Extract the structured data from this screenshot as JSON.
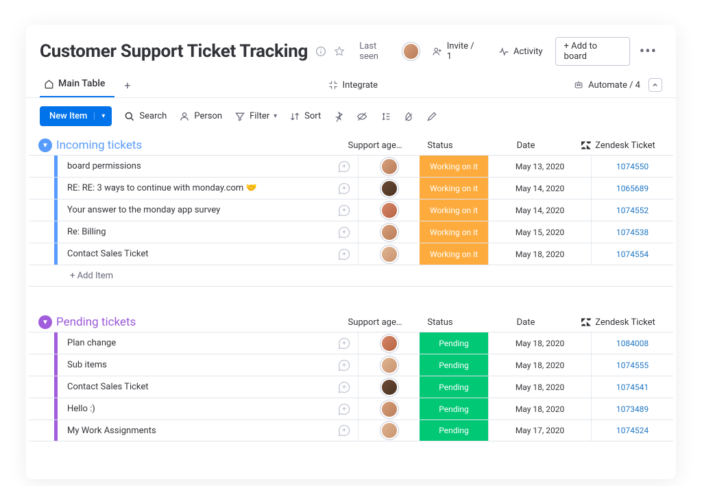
{
  "header": {
    "title": "Customer Support Ticket Tracking",
    "last_seen_label": "Last seen",
    "invite_label": "Invite / 1",
    "activity_label": "Activity",
    "add_to_board_label": "+ Add to board"
  },
  "tabs": {
    "main_tab_label": "Main Table",
    "integrate_label": "Integrate",
    "automate_label": "Automate / 4"
  },
  "toolbar": {
    "new_item_label": "New Item",
    "search_label": "Search",
    "person_label": "Person",
    "filter_label": "Filter",
    "sort_label": "Sort"
  },
  "columns": {
    "agent": "Support age…",
    "status": "Status",
    "date": "Date",
    "zendesk": "Zendesk Ticket"
  },
  "status_labels": {
    "working": "Working on it",
    "pending": "Pending"
  },
  "groups": [
    {
      "id": "incoming",
      "color_class": "g-blue",
      "name": "Incoming tickets",
      "add_item_label": "+ Add Item",
      "rows": [
        {
          "title": "board permissions",
          "avatar": "a1",
          "status": "working",
          "date": "May 13, 2020",
          "zendesk": "1074550"
        },
        {
          "title": "RE: RE: 3 ways to continue with monday.com 🤝",
          "avatar": "a2",
          "status": "working",
          "date": "May 14, 2020",
          "zendesk": "1065689"
        },
        {
          "title": "Your answer to the monday app survey",
          "avatar": "a3",
          "status": "working",
          "date": "May 14, 2020",
          "zendesk": "1074552"
        },
        {
          "title": "Re: Billing",
          "avatar": "a1",
          "status": "working",
          "date": "May 15, 2020",
          "zendesk": "1074538"
        },
        {
          "title": "Contact Sales Ticket",
          "avatar": "a4",
          "status": "working",
          "date": "May 18, 2020",
          "zendesk": "1074554"
        }
      ]
    },
    {
      "id": "pending",
      "color_class": "g-purple",
      "name": "Pending tickets",
      "add_item_label": "+ Add Item",
      "rows": [
        {
          "title": "Plan change",
          "avatar": "a3",
          "status": "pending",
          "date": "May 18, 2020",
          "zendesk": "1084008"
        },
        {
          "title": "Sub items",
          "avatar": "a4",
          "status": "pending",
          "date": "May 18, 2020",
          "zendesk": "1074555"
        },
        {
          "title": "Contact Sales Ticket",
          "avatar": "a2",
          "status": "pending",
          "date": "May 18, 2020",
          "zendesk": "1074541"
        },
        {
          "title": "Hello :)",
          "avatar": "a1",
          "status": "pending",
          "date": "May 18, 2020",
          "zendesk": "1073489"
        },
        {
          "title": "My Work Assignments",
          "avatar": "a4",
          "status": "pending",
          "date": "May 17, 2020",
          "zendesk": "1074524"
        }
      ]
    }
  ]
}
